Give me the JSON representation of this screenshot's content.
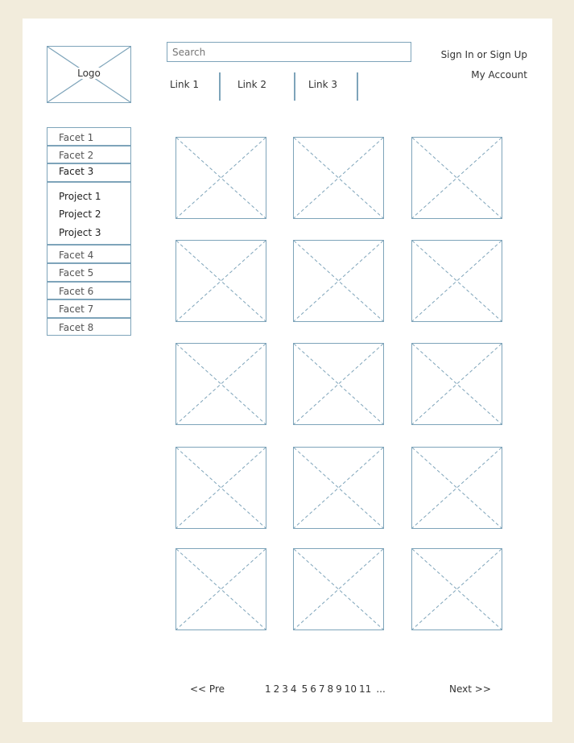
{
  "header": {
    "logo_label": "Logo",
    "search_placeholder": "Search",
    "nav_links": [
      "Link 1",
      "Link 2",
      "Link 3"
    ],
    "sign_in": "Sign In or Sign Up",
    "my_account": "My Account"
  },
  "sidebar": {
    "facets_top": [
      "Facet 1",
      "Facet 2",
      "Facet 3"
    ],
    "projects": [
      "Project 1",
      "Project 2",
      "Project 3"
    ],
    "facets_bottom": [
      "Facet 4",
      "Facet 5",
      "Facet 6",
      "Facet 7",
      "Facet 8"
    ]
  },
  "grid": {
    "rows": 5,
    "columns": 3,
    "item_icon": "image-placeholder-icon"
  },
  "pagination": {
    "prev": "<< Pre",
    "pages": [
      "1",
      "2",
      "3",
      "4",
      "5",
      "6",
      "7",
      "8",
      "9",
      "10",
      "11"
    ],
    "ellipsis": "...",
    "next": "Next >>"
  },
  "colors": {
    "background": "#f2ecdc",
    "page": "#ffffff",
    "wireframe_stroke": "#7ea4ba"
  }
}
